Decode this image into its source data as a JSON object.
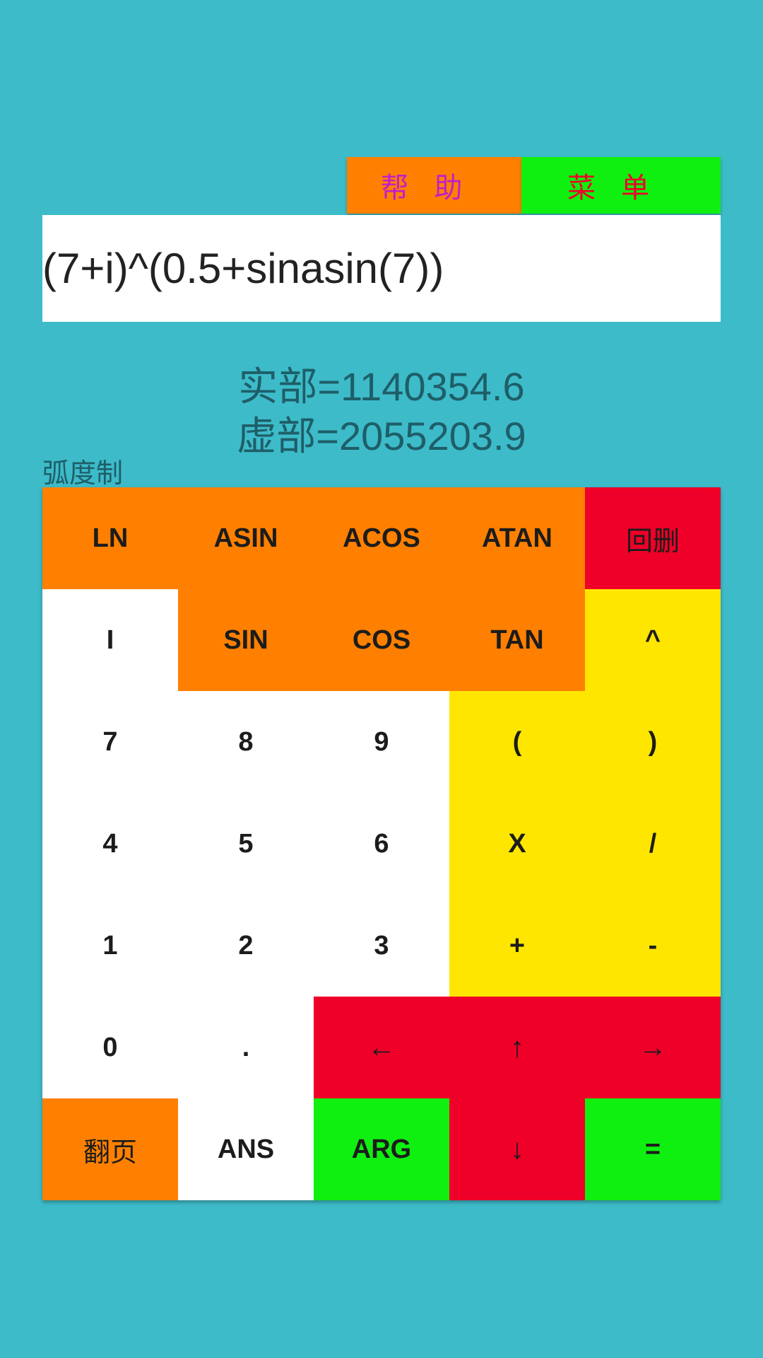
{
  "header": {
    "help_label": "帮助",
    "menu_label": "菜单"
  },
  "expression": {
    "value": "(7+i)^(0.5+sinasin(7))"
  },
  "result": {
    "real": "实部=1140354.6",
    "imag": "虚部=2055203.9"
  },
  "angle_mode": "弧度制",
  "colors": {
    "background": "#3dbbc9",
    "orange": "#ff8000",
    "red": "#ee0028",
    "yellow": "#ffe600",
    "green": "#10f010",
    "white": "#ffffff"
  },
  "keys": [
    {
      "label": "LN",
      "color": "orange",
      "name": "key-ln"
    },
    {
      "label": "ASIN",
      "color": "orange",
      "name": "key-asin"
    },
    {
      "label": "ACOS",
      "color": "orange",
      "name": "key-acos"
    },
    {
      "label": "ATAN",
      "color": "orange",
      "name": "key-atan"
    },
    {
      "label": "回删",
      "color": "red",
      "name": "key-backspace"
    },
    {
      "label": "I",
      "color": "white",
      "name": "key-i"
    },
    {
      "label": "SIN",
      "color": "orange",
      "name": "key-sin"
    },
    {
      "label": "COS",
      "color": "orange",
      "name": "key-cos"
    },
    {
      "label": "TAN",
      "color": "orange",
      "name": "key-tan"
    },
    {
      "label": "^",
      "color": "yellow",
      "name": "key-power"
    },
    {
      "label": "7",
      "color": "white",
      "name": "key-7"
    },
    {
      "label": "8",
      "color": "white",
      "name": "key-8"
    },
    {
      "label": "9",
      "color": "white",
      "name": "key-9"
    },
    {
      "label": "(",
      "color": "yellow",
      "name": "key-open-paren"
    },
    {
      "label": ")",
      "color": "yellow",
      "name": "key-close-paren"
    },
    {
      "label": "4",
      "color": "white",
      "name": "key-4"
    },
    {
      "label": "5",
      "color": "white",
      "name": "key-5"
    },
    {
      "label": "6",
      "color": "white",
      "name": "key-6"
    },
    {
      "label": "X",
      "color": "yellow",
      "name": "key-multiply"
    },
    {
      "label": "/",
      "color": "yellow",
      "name": "key-divide"
    },
    {
      "label": "1",
      "color": "white",
      "name": "key-1"
    },
    {
      "label": "2",
      "color": "white",
      "name": "key-2"
    },
    {
      "label": "3",
      "color": "white",
      "name": "key-3"
    },
    {
      "label": "+",
      "color": "yellow",
      "name": "key-plus"
    },
    {
      "label": "-",
      "color": "yellow",
      "name": "key-minus"
    },
    {
      "label": "0",
      "color": "white",
      "name": "key-0"
    },
    {
      "label": ".",
      "color": "white",
      "name": "key-decimal"
    },
    {
      "label": "←",
      "color": "red",
      "name": "key-left-arrow"
    },
    {
      "label": "↑",
      "color": "red",
      "name": "key-up-arrow"
    },
    {
      "label": "→",
      "color": "red",
      "name": "key-right-arrow"
    },
    {
      "label": "翻页",
      "color": "orange",
      "name": "key-page-turn"
    },
    {
      "label": "ANS",
      "color": "white",
      "name": "key-ans"
    },
    {
      "label": "ARG",
      "color": "green",
      "name": "key-arg"
    },
    {
      "label": "↓",
      "color": "red",
      "name": "key-down-arrow"
    },
    {
      "label": "=",
      "color": "green",
      "name": "key-equals"
    }
  ]
}
